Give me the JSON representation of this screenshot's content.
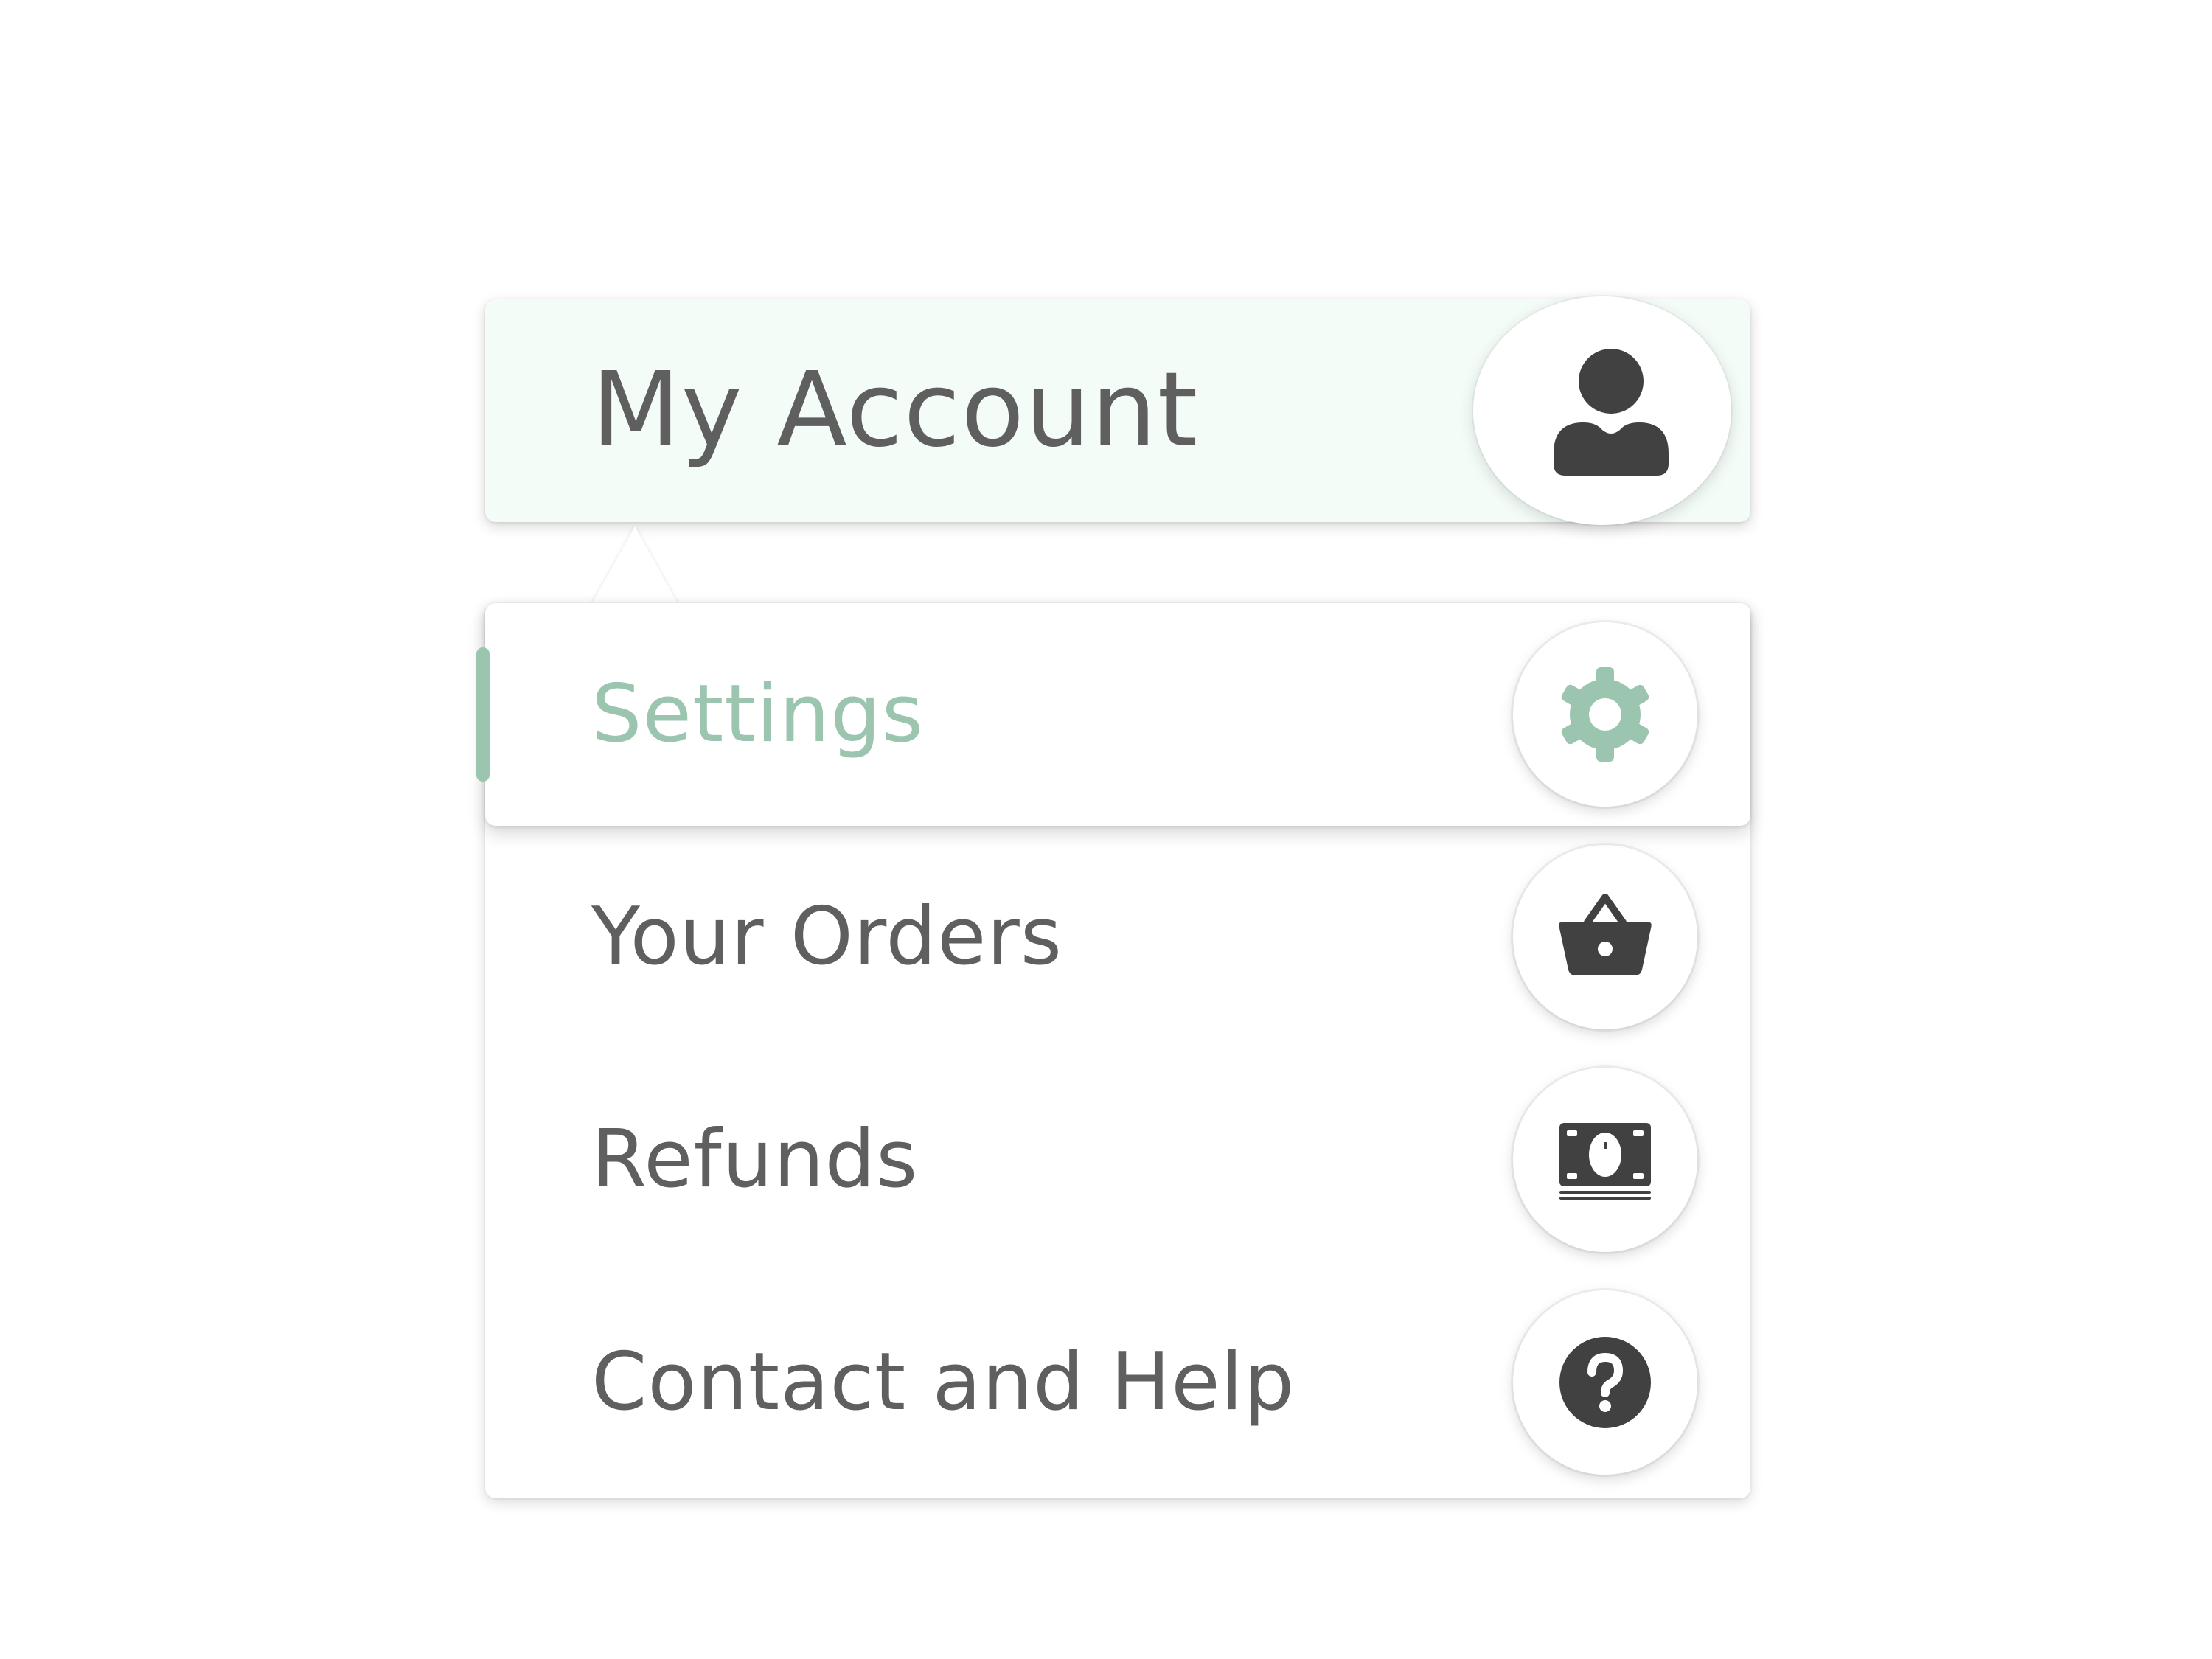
{
  "header": {
    "title": "My Account",
    "avatar_icon": "user-icon"
  },
  "menu": {
    "items": [
      {
        "label": "Settings",
        "icon": "gear-icon",
        "active": true
      },
      {
        "label": "Your Orders",
        "icon": "basket-icon",
        "active": false
      },
      {
        "label": "Refunds",
        "icon": "banknote-icon",
        "active": false
      },
      {
        "label": "Contact and Help",
        "icon": "help-icon",
        "active": false
      }
    ]
  },
  "colors": {
    "accent": "#9cc5b0",
    "header_bg": "#f4fcf7",
    "text": "#5f5f5f",
    "icon": "#414141"
  }
}
